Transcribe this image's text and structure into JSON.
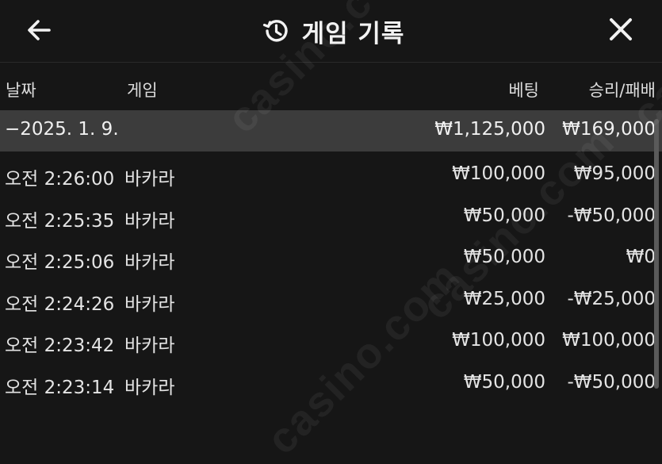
{
  "header": {
    "back_icon": "arrow-left-icon",
    "history_icon": "history-icon",
    "title": "게임 기록",
    "close_icon": "close-icon"
  },
  "columns": {
    "date": "날짜",
    "game": "게임",
    "bet": "베팅",
    "win_loss": "승리/패배"
  },
  "group": {
    "date": "−2025. 1. 9.",
    "bet": "₩1,125,000",
    "win_loss": "₩169,000"
  },
  "rows": [
    {
      "time": "오전 2:26:00",
      "game": "바카라",
      "bet": "₩100,000",
      "win_loss": "₩95,000"
    },
    {
      "time": "오전 2:25:35",
      "game": "바카라",
      "bet": "₩50,000",
      "win_loss": "-₩50,000"
    },
    {
      "time": "오전 2:25:06",
      "game": "바카라",
      "bet": "₩50,000",
      "win_loss": "₩0"
    },
    {
      "time": "오전 2:24:26",
      "game": "바카라",
      "bet": "₩25,000",
      "win_loss": "-₩25,000"
    },
    {
      "time": "오전 2:23:42",
      "game": "바카라",
      "bet": "₩100,000",
      "win_loss": "₩100,000"
    },
    {
      "time": "오전 2:23:14",
      "game": "바카라",
      "bet": "₩50,000",
      "win_loss": "-₩50,000"
    }
  ],
  "watermark": "casino.com",
  "colors": {
    "background": "#161616",
    "group_row": "#3c3c3c",
    "text": "#e8e8e8"
  }
}
